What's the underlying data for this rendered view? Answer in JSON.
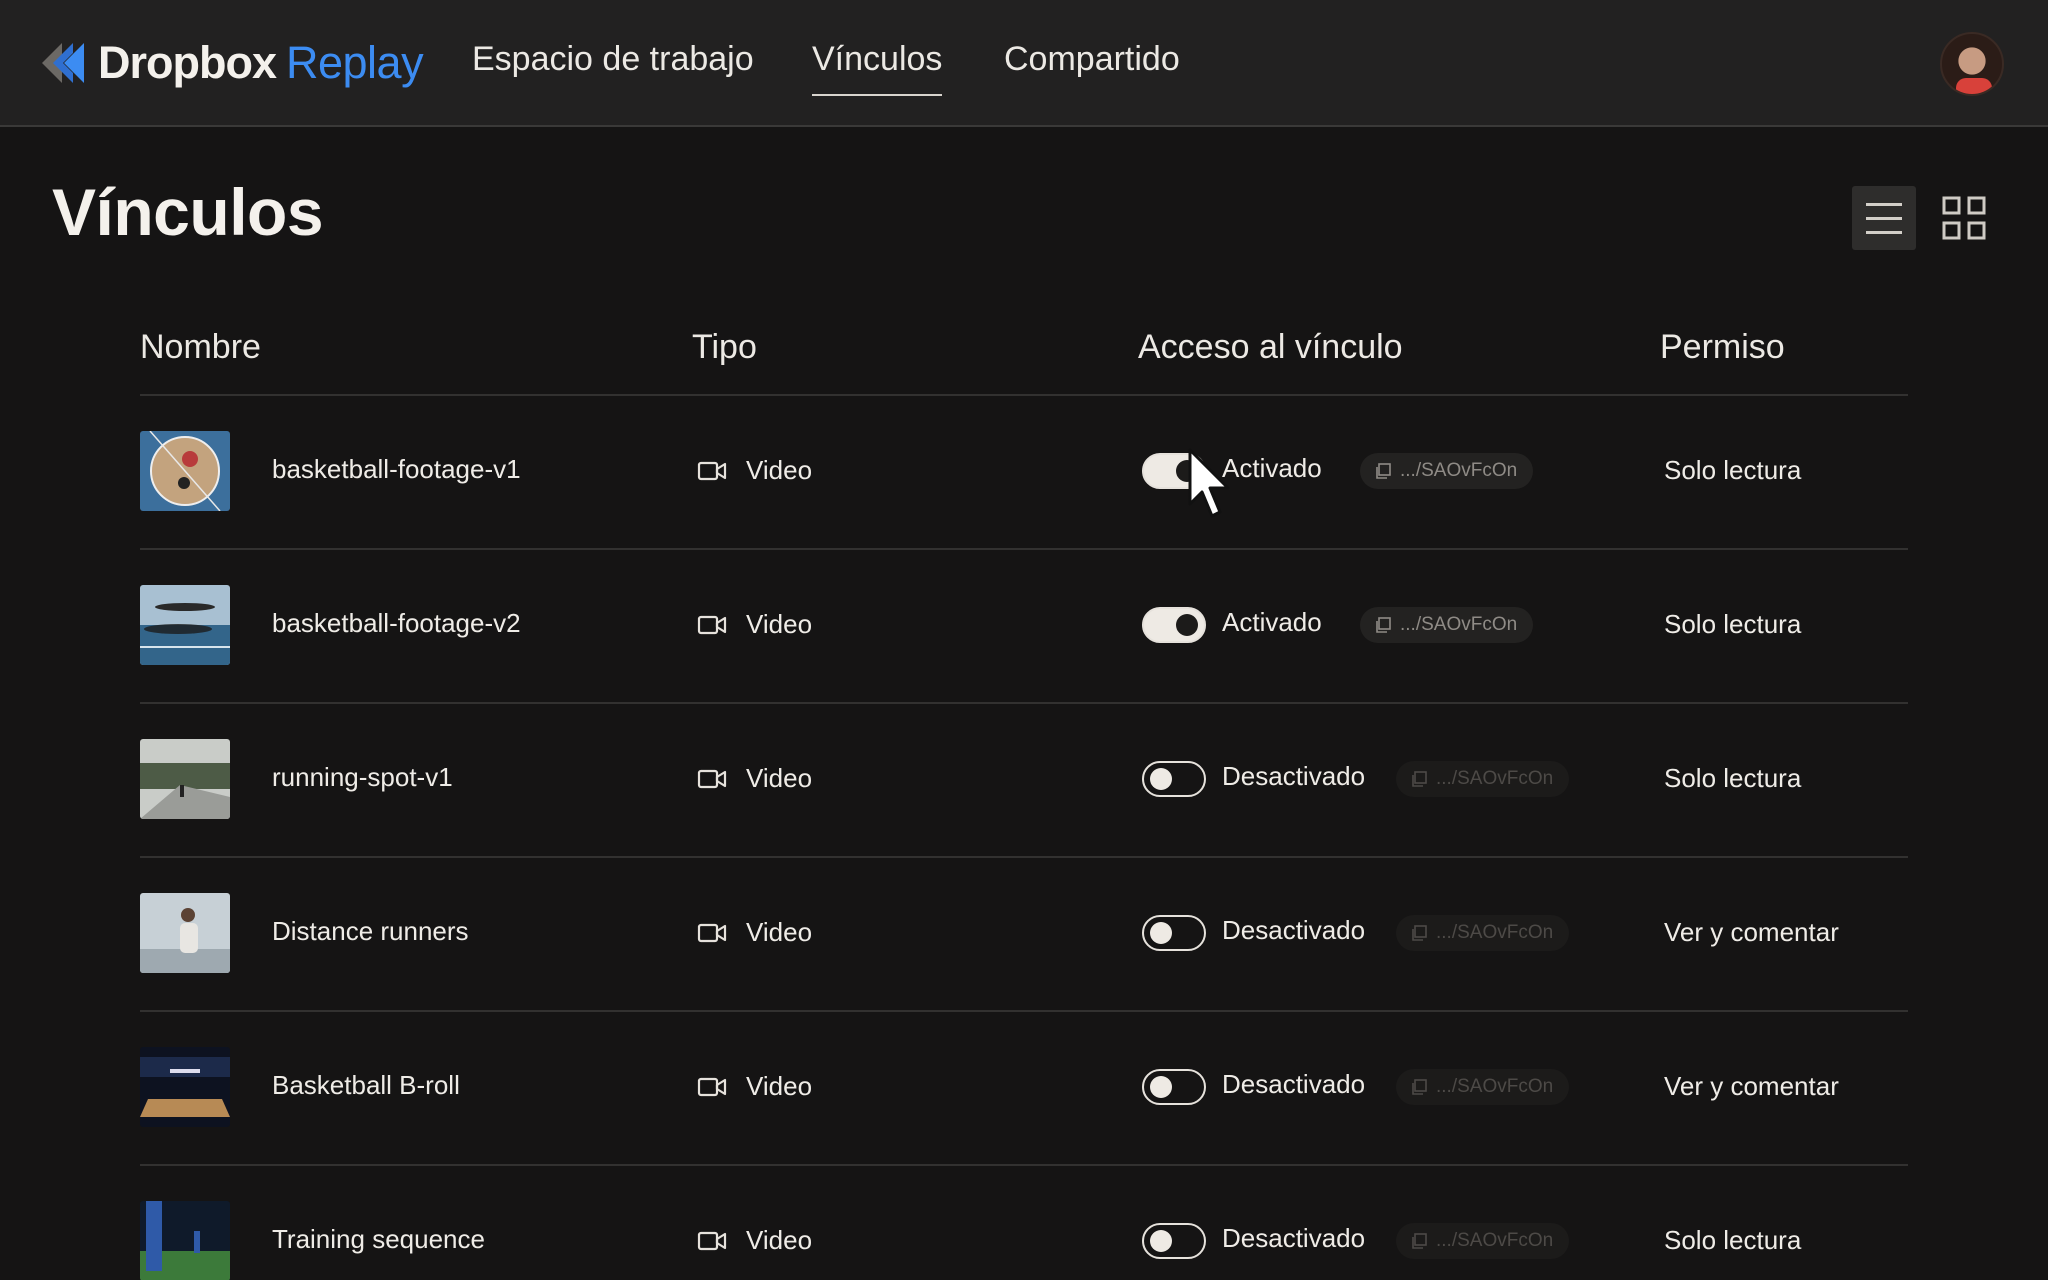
{
  "app": {
    "brand": "Dropbox",
    "product": "Replay",
    "brand_color": "#3c8cf2"
  },
  "nav": {
    "items": [
      {
        "label": "Espacio de trabajo",
        "active": false
      },
      {
        "label": "Vínculos",
        "active": true
      },
      {
        "label": "Compartido",
        "active": false
      }
    ]
  },
  "page": {
    "title": "Vínculos",
    "view_mode": "list"
  },
  "table": {
    "columns": [
      "Nombre",
      "Tipo",
      "Acceso al vínculo",
      "Permiso"
    ],
    "rows": [
      {
        "name": "basketball-footage-v1",
        "type": "Video",
        "access_on": true,
        "status": "Activado",
        "link": ".../SAOvFcOn",
        "permission": "Solo lectura",
        "thumb": "basketball-overhead"
      },
      {
        "name": "basketball-footage-v2",
        "type": "Video",
        "access_on": true,
        "status": "Activado",
        "link": ".../SAOvFcOn",
        "permission": "Solo lectura",
        "thumb": "basketball-court-aerial"
      },
      {
        "name": "running-spot-v1",
        "type": "Video",
        "access_on": false,
        "status": "Desactivado",
        "link": ".../SAOvFcOn",
        "permission": "Solo lectura",
        "thumb": "road-runner"
      },
      {
        "name": "Distance runners",
        "type": "Video",
        "access_on": false,
        "status": "Desactivado",
        "link": ".../SAOvFcOn",
        "permission": "Ver y comentar",
        "thumb": "runner-sky"
      },
      {
        "name": "Basketball B-roll",
        "type": "Video",
        "access_on": false,
        "status": "Desactivado",
        "link": ".../SAOvFcOn",
        "permission": "Ver y comentar",
        "thumb": "arena"
      },
      {
        "name": "Training sequence",
        "type": "Video",
        "access_on": false,
        "status": "Desactivado",
        "link": ".../SAOvFcOn",
        "permission": "Solo lectura",
        "thumb": "soccer-field"
      }
    ]
  }
}
